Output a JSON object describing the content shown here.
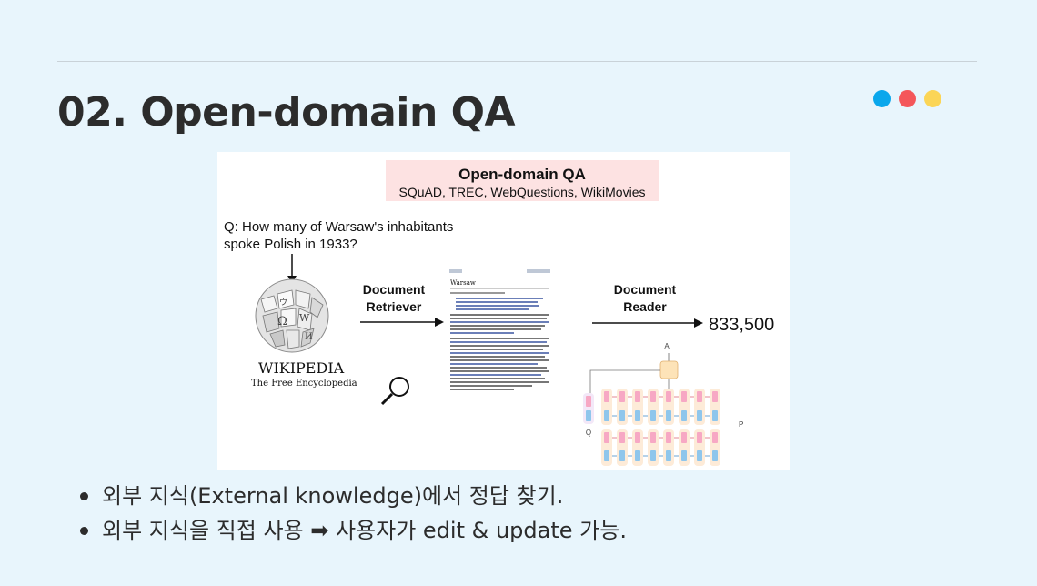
{
  "slide": {
    "title": "02. Open-domain QA",
    "dots": [
      "#0aa7ec",
      "#f4565a",
      "#fbd556"
    ],
    "bullets": [
      "외부 지식(External knowledge)에서 정답 찾기.",
      "외부 지식을 직접 사용 ➡ 사용자가 edit & update 가능."
    ]
  },
  "figure": {
    "banner_title": "Open-domain QA",
    "banner_subtitle": "SQuAD, TREC, WebQuestions, WikiMovies",
    "question_line1": "Q:  How many of Warsaw's inhabitants",
    "question_line2": "spoke Polish in 1933?",
    "wiki_name": "WIKIPEDIA",
    "wiki_tagline": "The Free Encyclopedia",
    "retriever_line1": "Document",
    "retriever_line2": "Retriever",
    "reader_line1": "Document",
    "reader_line2": "Reader",
    "answer": "833,500",
    "article_title": "Warsaw",
    "label_a": "A",
    "label_q": "Q",
    "label_p": "P"
  }
}
